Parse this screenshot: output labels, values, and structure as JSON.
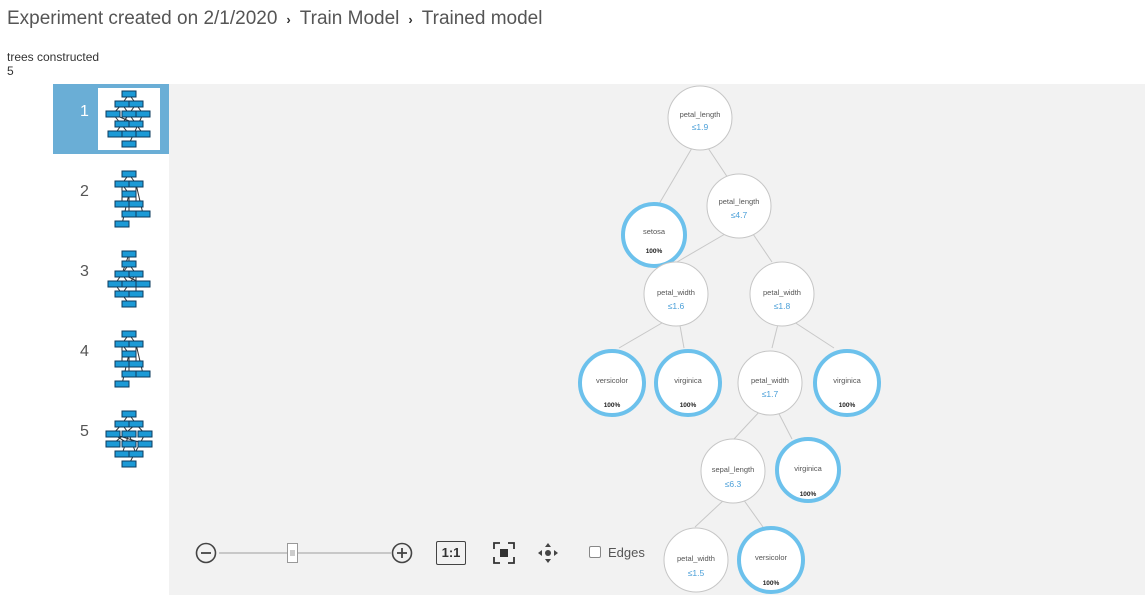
{
  "breadcrumb": {
    "items": [
      "Experiment created on 2/1/2020",
      "Train Model",
      "Trained model"
    ],
    "separator": "›"
  },
  "meta": {
    "label": "trees constructed",
    "value": "5"
  },
  "sidebar": {
    "trees": [
      {
        "number": "1",
        "selected": true,
        "icon": "tree-thumbnail-icon"
      },
      {
        "number": "2",
        "selected": false,
        "icon": "tree-thumbnail-icon"
      },
      {
        "number": "3",
        "selected": false,
        "icon": "tree-thumbnail-icon"
      },
      {
        "number": "4",
        "selected": false,
        "icon": "tree-thumbnail-icon"
      },
      {
        "number": "5",
        "selected": false,
        "icon": "tree-thumbnail-icon"
      }
    ]
  },
  "tree": {
    "nodes": [
      {
        "id": "n1",
        "feature": "petal_length",
        "threshold": "≤1.9"
      },
      {
        "id": "n2",
        "class": "setosa",
        "percent": "100%"
      },
      {
        "id": "n3",
        "feature": "petal_length",
        "threshold": "≤4.7"
      },
      {
        "id": "n4",
        "feature": "petal_width",
        "threshold": "≤1.6"
      },
      {
        "id": "n5",
        "feature": "petal_width",
        "threshold": "≤1.8"
      },
      {
        "id": "n6",
        "class": "versicolor",
        "percent": "100%"
      },
      {
        "id": "n7",
        "class": "virginica",
        "percent": "100%"
      },
      {
        "id": "n8",
        "feature": "petal_width",
        "threshold": "≤1.7"
      },
      {
        "id": "n9",
        "class": "virginica",
        "percent": "100%"
      },
      {
        "id": "n10",
        "feature": "sepal_length",
        "threshold": "≤6.3"
      },
      {
        "id": "n11",
        "class": "virginica",
        "percent": "100%"
      },
      {
        "id": "n12",
        "feature": "petal_width",
        "threshold": "≤1.5"
      },
      {
        "id": "n13",
        "class": "versicolor",
        "percent": "100%"
      }
    ]
  },
  "toolbar": {
    "zoom_out_icon": "zoom-out-icon",
    "zoom_in_icon": "zoom-in-icon",
    "actual_size_label": "1:1",
    "fit_icon": "fit-to-screen-icon",
    "pan_icon": "pan-icon",
    "edges_label": "Edges",
    "edges_checked": false
  },
  "colors": {
    "selected_bg": "#6aaed6",
    "leaf_ring": "#6cc1ec",
    "threshold_text": "#4a9fd8",
    "thumb_fill": "#1c9ad6",
    "canvas_bg": "#f2f2f2"
  }
}
